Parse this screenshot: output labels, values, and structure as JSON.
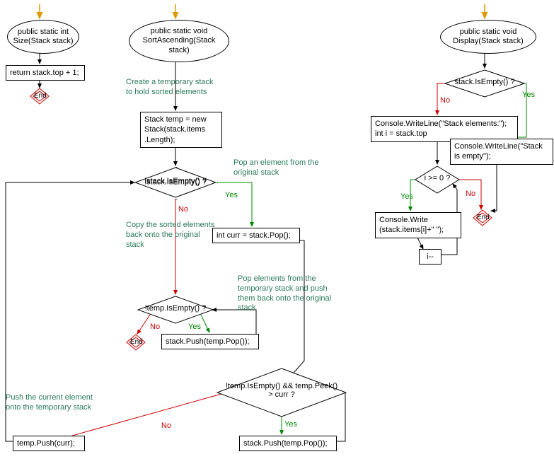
{
  "chart_data": {
    "type": "flowchart",
    "flows": [
      {
        "name": "Size",
        "nodes": [
          {
            "id": "s_start",
            "type": "start"
          },
          {
            "id": "s_sig",
            "type": "terminator",
            "text": "public static int Size(Stack stack)"
          },
          {
            "id": "s_ret",
            "type": "process",
            "text": "return stack.top + 1;"
          },
          {
            "id": "s_end",
            "type": "end",
            "text": "End"
          }
        ],
        "edges": [
          [
            "s_start",
            "s_sig"
          ],
          [
            "s_sig",
            "s_ret"
          ],
          [
            "s_ret",
            "s_end"
          ]
        ]
      },
      {
        "name": "SortAscending",
        "nodes": [
          {
            "id": "a_start",
            "type": "start"
          },
          {
            "id": "a_sig",
            "type": "terminator",
            "text": "public static void SortAscending(Stack stack)"
          },
          {
            "id": "a_note1",
            "type": "annotation",
            "text": "Create a temporary stack to hold sorted elements"
          },
          {
            "id": "a_tmp",
            "type": "process",
            "text": "Stack temp = new Stack(stack.items.Length);"
          },
          {
            "id": "a_d1",
            "type": "decision",
            "text": "!stack.IsEmpty() ?"
          },
          {
            "id": "a_note2",
            "type": "annotation",
            "text": "Pop an element from the original stack"
          },
          {
            "id": "a_curr",
            "type": "process",
            "text": "int curr = stack.Pop();"
          },
          {
            "id": "a_note3",
            "type": "annotation",
            "text": "Pop elements from the temporary stack and push them back onto the original stack"
          },
          {
            "id": "a_d2",
            "type": "decision",
            "text": "!temp.IsEmpty() && temp.Peek() > curr ?"
          },
          {
            "id": "a_push1",
            "type": "process",
            "text": "stack.Push(temp.Pop());"
          },
          {
            "id": "a_note4",
            "type": "annotation",
            "text": "Push the current element onto the temporary stack"
          },
          {
            "id": "a_push2",
            "type": "process",
            "text": "temp.Push(curr);"
          },
          {
            "id": "a_note5",
            "type": "annotation",
            "text": "Copy the sorted elements back onto the original stack"
          },
          {
            "id": "a_d3",
            "type": "decision",
            "text": "!temp.IsEmpty() ?"
          },
          {
            "id": "a_push3",
            "type": "process",
            "text": "stack.Push(temp.Pop());"
          },
          {
            "id": "a_end",
            "type": "end",
            "text": "End"
          }
        ],
        "edges": [
          [
            "a_start",
            "a_sig"
          ],
          [
            "a_sig",
            "a_tmp"
          ],
          [
            "a_tmp",
            "a_d1"
          ],
          [
            "a_d1",
            "a_curr",
            "Yes"
          ],
          [
            "a_curr",
            "a_d2"
          ],
          [
            "a_d2",
            "a_push1",
            "Yes"
          ],
          [
            "a_push1",
            "a_d2"
          ],
          [
            "a_d2",
            "a_push2",
            "No"
          ],
          [
            "a_push2",
            "a_d1"
          ],
          [
            "a_d1",
            "a_d3",
            "No"
          ],
          [
            "a_d3",
            "a_push3",
            "Yes"
          ],
          [
            "a_push3",
            "a_d3"
          ],
          [
            "a_d3",
            "a_end",
            "No"
          ]
        ]
      },
      {
        "name": "Display",
        "nodes": [
          {
            "id": "d_start",
            "type": "start"
          },
          {
            "id": "d_sig",
            "type": "terminator",
            "text": "public static void Display(Stack stack)"
          },
          {
            "id": "d_d1",
            "type": "decision",
            "text": "stack.IsEmpty() ?"
          },
          {
            "id": "d_p1",
            "type": "process",
            "text": "Console.WriteLine(\"Stack elements:\"); int i = stack.top"
          },
          {
            "id": "d_p2",
            "type": "process",
            "text": "Console.WriteLine(\"Stack is empty\");"
          },
          {
            "id": "d_d2",
            "type": "decision",
            "text": "i >= 0 ?"
          },
          {
            "id": "d_p3",
            "type": "process",
            "text": "Console.Write(stack.items[i]+\" \");"
          },
          {
            "id": "d_p4",
            "type": "process",
            "text": "i--"
          },
          {
            "id": "d_end",
            "type": "end",
            "text": "End"
          }
        ],
        "edges": [
          [
            "d_start",
            "d_sig"
          ],
          [
            "d_sig",
            "d_d1"
          ],
          [
            "d_d1",
            "d_p1",
            "No"
          ],
          [
            "d_d1",
            "d_p2",
            "Yes"
          ],
          [
            "d_p1",
            "d_d2"
          ],
          [
            "d_d2",
            "d_p3",
            "Yes"
          ],
          [
            "d_p3",
            "d_p4"
          ],
          [
            "d_p4",
            "d_d2"
          ],
          [
            "d_d2",
            "d_end",
            "No"
          ],
          [
            "d_p2",
            "d_end"
          ]
        ]
      }
    ]
  },
  "labels": {
    "yes": "Yes",
    "no": "No",
    "end": "End"
  },
  "n": {
    "size_sig": "public static int\nSize(Stack stack)",
    "size_ret": "return stack.top + 1;",
    "sort_sig": "public static void\nSortAscending(Stack\nstack)",
    "sort_note1": "Create a temporary stack\nto hold sorted elements",
    "sort_tmp": "Stack temp = new\nStack(stack.items\n.Length);",
    "sort_d1": "!stack.IsEmpty() ?",
    "sort_note2": "Pop an element from the\noriginal stack",
    "sort_curr": "int curr = stack.Pop();",
    "sort_note3": "Pop elements from the\ntemporary stack and push\nthem back onto the original\nstack",
    "sort_d2": "!temp.IsEmpty() && temp.Peek()\n> curr ?",
    "sort_push1": "stack.Push(temp.Pop());",
    "sort_note4": "Push the current element\nonto the temporary stack",
    "sort_push2": "temp.Push(curr);",
    "sort_note5": "Copy the sorted elements\nback onto the original\nstack",
    "sort_d3": "!temp.IsEmpty() ?",
    "sort_push3": "stack.Push(temp.Pop());",
    "disp_sig": "public static void\nDisplay(Stack stack)",
    "disp_d1": "stack.IsEmpty() ?",
    "disp_p1": "Console.WriteLine(\"Stack elements:\");\nint i = stack.top",
    "disp_p2": "Console.WriteLine(\"Stack\nis empty\");",
    "disp_d2": "i >= 0 ?",
    "disp_p3": "Console.Write\n(stack.items[i]+\" \");",
    "disp_p4": "i--",
    "end": "End"
  }
}
